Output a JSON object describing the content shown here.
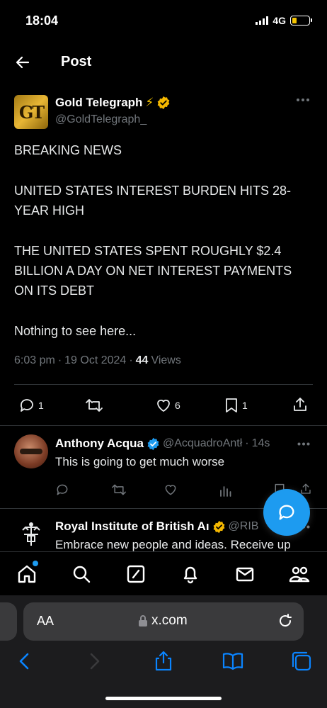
{
  "status": {
    "time": "18:04",
    "network": "4G"
  },
  "header": {
    "title": "Post"
  },
  "tweet": {
    "author_name": "Gold Telegraph",
    "author_emoji": "⚡",
    "handle": "@GoldTelegraph_",
    "avatar_text": "GT",
    "lines": [
      "BREAKING NEWS",
      "UNITED STATES INTEREST BURDEN HITS 28-",
      "YEAR HIGH",
      "THE UNITED STATES SPENT ROUGHLY $2.4",
      "BILLION A DAY ON NET INTEREST PAYMENTS",
      "ON ITS DEBT",
      "Nothing to see here..."
    ],
    "time": "6:03 pm",
    "date": "19 Oct 2024",
    "views_count": "44",
    "views_label": "Views",
    "reply_count": "1",
    "like_count": "6",
    "bookmark_count": "1"
  },
  "replies": [
    {
      "name": "Anthony Acqua",
      "handle": "@AcquadroAntł",
      "time": "14s",
      "text": "This is going to get much worse"
    },
    {
      "name": "Royal Institute of British Aı",
      "handle": "@RIB",
      "text": "Embrace new people and ideas. Receive up"
    }
  ],
  "browser": {
    "aa": "AA",
    "url": "x.com"
  },
  "colors": {
    "accent": "#1d9bf0",
    "verified": "#f5b800",
    "battery": "#f5c400"
  }
}
